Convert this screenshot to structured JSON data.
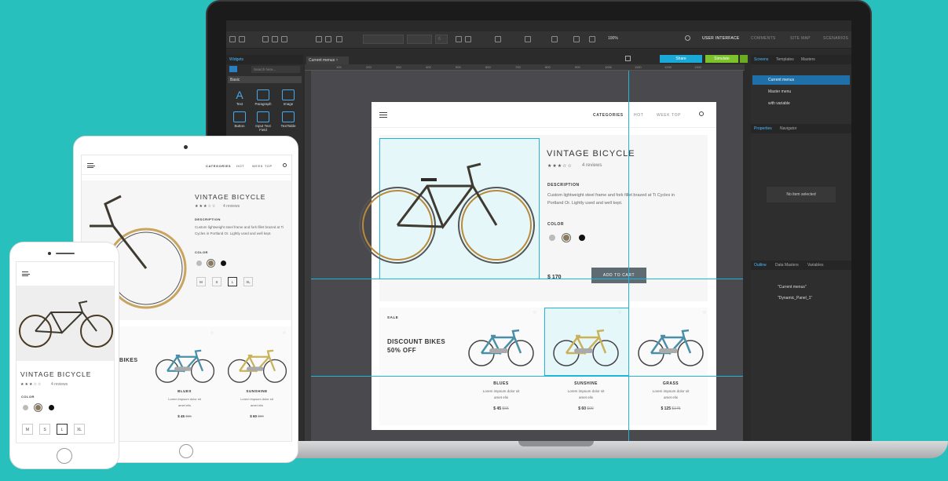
{
  "app": {
    "toolbar": {
      "zoom": "100%",
      "tabs": [
        "USER INTERFACE",
        "COMMENTS",
        "SITE MAP",
        "SCENARIOS"
      ],
      "font_size_dd": "6"
    },
    "left_panel": {
      "tab": "Widgets",
      "search_placeholder": "Search here...",
      "category": "Basic",
      "widgets": [
        "Text",
        "Paragraph",
        "Image",
        "Button",
        "Input Text Field",
        "TextTable"
      ]
    },
    "canvas": {
      "tab": "Current menus",
      "share_label": "Share",
      "simulate_label": "Simulate",
      "ruler_marks": [
        "100",
        "200",
        "300",
        "400",
        "500",
        "600",
        "700",
        "800",
        "900",
        "1000",
        "1100",
        "1200",
        "1300"
      ]
    },
    "right_panel": {
      "tabs": [
        "Screens",
        "Templates",
        "Masters"
      ],
      "screens": [
        "Current menus",
        "Master menu",
        "with variable"
      ],
      "props_tabs": [
        "Properties",
        "Navigator"
      ],
      "no_item": "No item selected",
      "outline_tabs": [
        "Outline",
        "Data Masters",
        "Variables"
      ],
      "outline_items": [
        "\"Current menus\"",
        "\"Dynamic_Panel_1\""
      ]
    }
  },
  "site": {
    "nav": [
      "CATEGORIES",
      "HOT",
      "WEEK TOP"
    ],
    "product": {
      "title": "VINTAGE BICYCLE",
      "stars": "★★★☆☆",
      "reviews": "4 reviews",
      "desc_label": "DESCRIPTION",
      "desc": "Custom lightweight steel frame and fork fillet brazed at Ti Cycles in Portland Or. Lightly used and well kept.",
      "color_label": "COLOR",
      "price": "$ 170",
      "cta": "ADD TO CART",
      "sizes": [
        "M",
        "S",
        "L",
        "XL"
      ]
    },
    "sale": {
      "label": "SALE",
      "heading": "DISCOUNT BIKES 50% OFF",
      "heading_short": "BIKES"
    },
    "bikes": [
      {
        "name": "BLUES",
        "desc": "Lorem impsum dolor sit amet elis",
        "price": "$ 45",
        "old": "$65"
      },
      {
        "name": "SUNSHINE",
        "desc": "Lorem impsum dolor sit amet elis",
        "price": "$ 60",
        "old": "$99"
      },
      {
        "name": "GRASS",
        "desc": "Lorem impsum dolor sit amet elis",
        "price": "$ 125",
        "old": "$175"
      }
    ]
  },
  "colors": {
    "background": "#27c0bd",
    "accent_blue": "#1fb5d9",
    "share": "#1aa9d6",
    "simulate": "#7cc22b",
    "cta": "#5e6b73"
  }
}
